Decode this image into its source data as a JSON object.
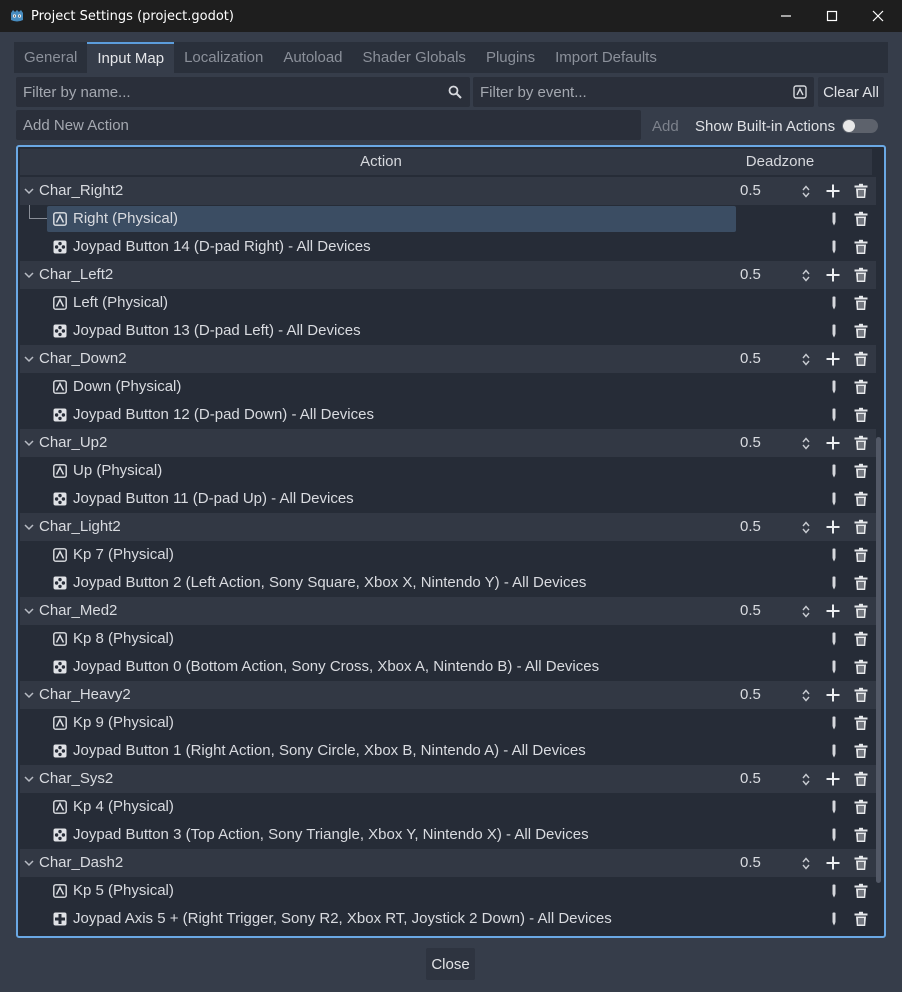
{
  "window": {
    "title": "Project Settings (project.godot)"
  },
  "tabs": [
    {
      "label": "General",
      "active": false
    },
    {
      "label": "Input Map",
      "active": true
    },
    {
      "label": "Localization",
      "active": false
    },
    {
      "label": "Autoload",
      "active": false
    },
    {
      "label": "Shader Globals",
      "active": false
    },
    {
      "label": "Plugins",
      "active": false
    },
    {
      "label": "Import Defaults",
      "active": false
    }
  ],
  "filters": {
    "by_name_placeholder": "Filter by name...",
    "by_event_placeholder": "Filter by event...",
    "clear_all": "Clear All"
  },
  "add_action": {
    "placeholder": "Add New Action",
    "add_label": "Add",
    "show_builtin_label": "Show Built-in Actions",
    "show_builtin_on": false
  },
  "columns": {
    "action": "Action",
    "deadzone": "Deadzone"
  },
  "actions": [
    {
      "name": "Char_Right2",
      "deadzone": "0.5",
      "events": [
        {
          "type": "key",
          "label": "Right (Physical)",
          "selected": true
        },
        {
          "type": "joypad",
          "label": "Joypad Button 14 (D-pad Right) - All Devices"
        }
      ]
    },
    {
      "name": "Char_Left2",
      "deadzone": "0.5",
      "events": [
        {
          "type": "key",
          "label": "Left (Physical)"
        },
        {
          "type": "joypad",
          "label": "Joypad Button 13 (D-pad Left) - All Devices"
        }
      ]
    },
    {
      "name": "Char_Down2",
      "deadzone": "0.5",
      "events": [
        {
          "type": "key",
          "label": "Down (Physical)"
        },
        {
          "type": "joypad",
          "label": "Joypad Button 12 (D-pad Down) - All Devices"
        }
      ]
    },
    {
      "name": "Char_Up2",
      "deadzone": "0.5",
      "events": [
        {
          "type": "key",
          "label": "Up (Physical)"
        },
        {
          "type": "joypad",
          "label": "Joypad Button 11 (D-pad Up) - All Devices"
        }
      ]
    },
    {
      "name": "Char_Light2",
      "deadzone": "0.5",
      "events": [
        {
          "type": "key",
          "label": "Kp 7 (Physical)"
        },
        {
          "type": "joypad",
          "label": "Joypad Button 2 (Left Action, Sony Square, Xbox X, Nintendo Y) - All Devices"
        }
      ]
    },
    {
      "name": "Char_Med2",
      "deadzone": "0.5",
      "events": [
        {
          "type": "key",
          "label": "Kp 8 (Physical)"
        },
        {
          "type": "joypad",
          "label": "Joypad Button 0 (Bottom Action, Sony Cross, Xbox A, Nintendo B) - All Devices"
        }
      ]
    },
    {
      "name": "Char_Heavy2",
      "deadzone": "0.5",
      "events": [
        {
          "type": "key",
          "label": "Kp 9 (Physical)"
        },
        {
          "type": "joypad",
          "label": "Joypad Button 1 (Right Action, Sony Circle, Xbox B, Nintendo A) - All Devices"
        }
      ]
    },
    {
      "name": "Char_Sys2",
      "deadzone": "0.5",
      "events": [
        {
          "type": "key",
          "label": "Kp 4 (Physical)"
        },
        {
          "type": "joypad",
          "label": "Joypad Button 3 (Top Action, Sony Triangle, Xbox Y, Nintendo X) - All Devices"
        }
      ]
    },
    {
      "name": "Char_Dash2",
      "deadzone": "0.5",
      "events": [
        {
          "type": "key",
          "label": "Kp 5 (Physical)"
        },
        {
          "type": "joyaxis",
          "label": "Joypad Axis 5 + (Right Trigger, Sony R2, Xbox RT, Joystick 2 Down) - All Devices"
        }
      ]
    }
  ],
  "footer": {
    "close_label": "Close"
  },
  "colors": {
    "accent": "#6aa8e4",
    "selection": "#3b4d63",
    "background": "#363d4a"
  }
}
